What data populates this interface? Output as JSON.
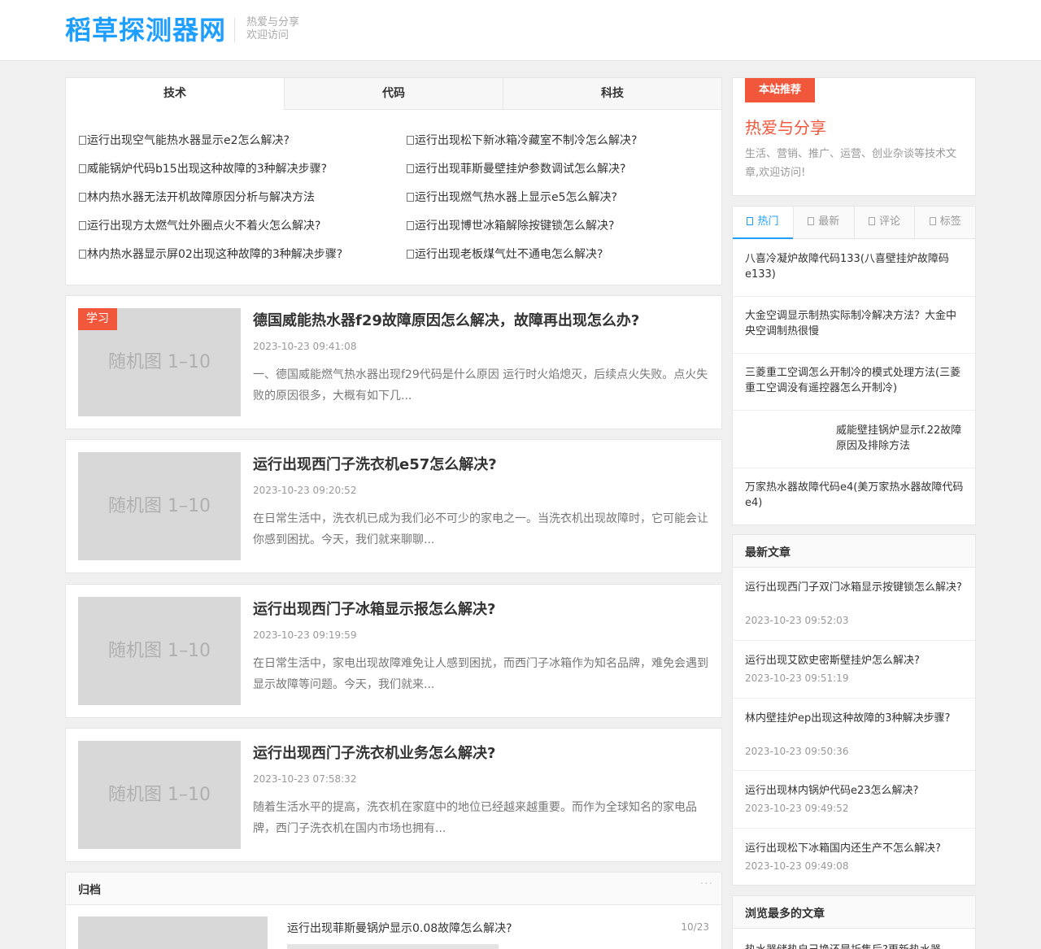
{
  "header": {
    "logo": "稻草探测器网",
    "tagline_1": "热爱与分享",
    "tagline_2": "欢迎访问"
  },
  "tabs": {
    "items": [
      "技术",
      "代码",
      "科技"
    ],
    "links": [
      "运行出现空气能热水器显示e2怎么解决?",
      "运行出现松下新冰箱冷藏室不制冷怎么解决?",
      "威能锅炉代码b15出现这种故障的3种解决步骤?",
      "运行出现菲斯曼壁挂炉参数调试怎么解决?",
      "林内热水器无法开机故障原因分析与解决方法",
      "运行出现燃气热水器上显示e5怎么解决?",
      "运行出现方太燃气灶外圈点火不着火怎么解决?",
      "运行出现博世冰箱解除按键锁怎么解决?",
      "林内热水器显示屏02出现这种故障的3种解决步骤?",
      "运行出现老板煤气灶不通电怎么解决?"
    ]
  },
  "articles": [
    {
      "tag": "学习",
      "thumb": "随机图 1–10",
      "title": "德国威能热水器f29故障原因怎么解决，故障再出现怎么办?",
      "date": "2023-10-23 09:41:08",
      "excerpt": "一、德国威能燃气热水器出现f29代码是什么原因 运行时火焰熄灭，后续点火失败。点火失败的原因很多，大概有如下几..."
    },
    {
      "thumb": "随机图 1–10",
      "title": "运行出现西门子洗衣机e57怎么解决?",
      "date": "2023-10-23 09:20:52",
      "excerpt": "在日常生活中，洗衣机已成为我们必不可少的家电之一。当洗衣机出现故障时，它可能会让你感到困扰。今天，我们就来聊聊..."
    },
    {
      "thumb": "随机图 1–10",
      "title": "运行出现西门子冰箱显示报怎么解决?",
      "date": "2023-10-23 09:19:59",
      "excerpt": "在日常生活中，家电出现故障难免让人感到困扰，而西门子冰箱作为知名品牌，难免会遇到显示故障等问题。今天，我们就来..."
    },
    {
      "thumb": "随机图 1–10",
      "title": "运行出现西门子洗衣机业务怎么解决?",
      "date": "2023-10-23 07:58:32",
      "excerpt": "随着生活水平的提高，洗衣机在家庭中的地位已经越来越重要。而作为全球知名的家电品牌，西门子洗衣机在国内市场也拥有..."
    }
  ],
  "archive": {
    "title": "归档",
    "more": "···",
    "item_title": "运行出现菲斯曼锅炉显示0.08故障怎么解决?",
    "item_date": "10/23"
  },
  "recommend": {
    "badge": "本站推荐",
    "title": "热爱与分享",
    "desc": "生活、营销、推广、运营、创业杂谈等技术文章,欢迎访问!"
  },
  "hot": {
    "tabs": [
      "热门",
      "最新",
      "评论",
      "标签"
    ],
    "items": [
      "八喜冷凝炉故障代码133(八喜壁挂炉故障码e133)",
      "大金空调显示制热实际制冷解决方法？大金中央空调制热很慢",
      "三菱重工空调怎么开制冷的模式处理方法(三菱重工空调没有遥控器怎么开制冷)",
      "威能壁挂锅炉显示f.22故障原因及排除方法",
      "万家热水器故障代码e4(美万家热水器故障代码e4)"
    ]
  },
  "latest": {
    "title": "最新文章",
    "items": [
      {
        "title": "运行出现西门子双门冰箱显示按键锁怎么解决?",
        "date": "2023-10-23 09:52:03"
      },
      {
        "title": "运行出现艾欧史密斯壁挂炉怎么解决?",
        "date": "2023-10-23 09:51:19"
      },
      {
        "title": "林内壁挂炉ep出现这种故障的3种解决步骤?",
        "date": "2023-10-23 09:50:36"
      },
      {
        "title": "运行出现林内锅炉代码e23怎么解决?",
        "date": "2023-10-23 09:49:52"
      },
      {
        "title": "运行出现松下冰箱国内还生产不怎么解决?",
        "date": "2023-10-23 09:49:08"
      }
    ]
  },
  "mostread": {
    "title": "浏览最多的文章",
    "item": "热水器储热自己换还是折售后?更新热水器"
  }
}
